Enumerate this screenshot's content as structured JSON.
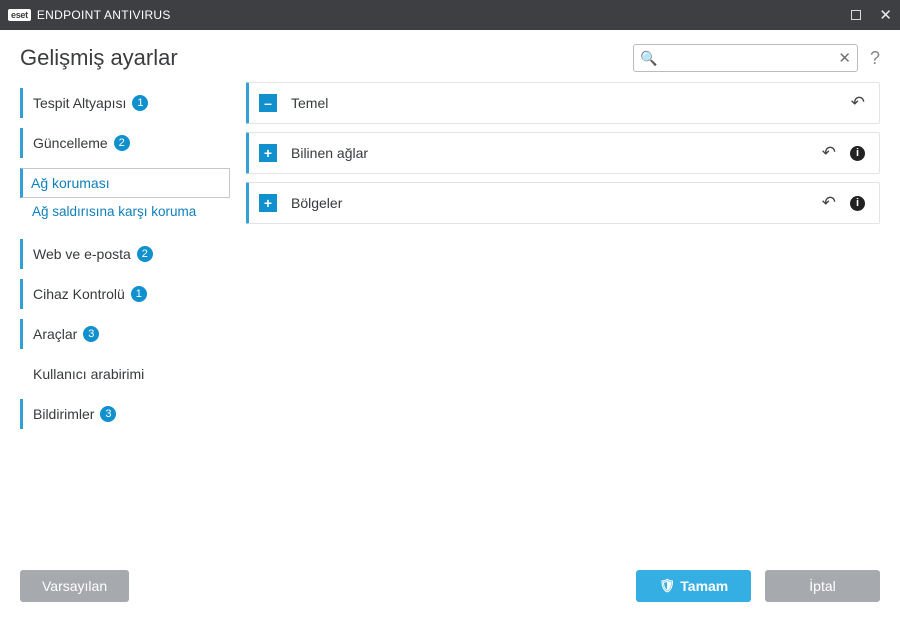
{
  "app": {
    "brand": "eset",
    "title": "ENDPOINT ANTIVIRUS"
  },
  "page_title": "Gelişmiş ayarlar",
  "search": {
    "value": "",
    "placeholder": ""
  },
  "sidebar": {
    "items": [
      {
        "label": "Tespit Altyapısı",
        "badge": "1"
      },
      {
        "label": "Güncelleme",
        "badge": "2"
      },
      {
        "label": "Ağ koruması",
        "sub": "Ağ saldırısına karşı koruma"
      },
      {
        "label": "Web ve e-posta",
        "badge": "2"
      },
      {
        "label": "Cihaz Kontrolü",
        "badge": "1"
      },
      {
        "label": "Araçlar",
        "badge": "3"
      },
      {
        "label": "Kullanıcı arabirimi"
      },
      {
        "label": "Bildirimler",
        "badge": "3"
      }
    ]
  },
  "panels": [
    {
      "title": "Temel",
      "expanded": true,
      "has_info": false
    },
    {
      "title": "Bilinen ağlar",
      "expanded": false,
      "has_info": true
    },
    {
      "title": "Bölgeler",
      "expanded": false,
      "has_info": true
    }
  ],
  "footer": {
    "default": "Varsayılan",
    "ok": "Tamam",
    "cancel": "İptal"
  }
}
